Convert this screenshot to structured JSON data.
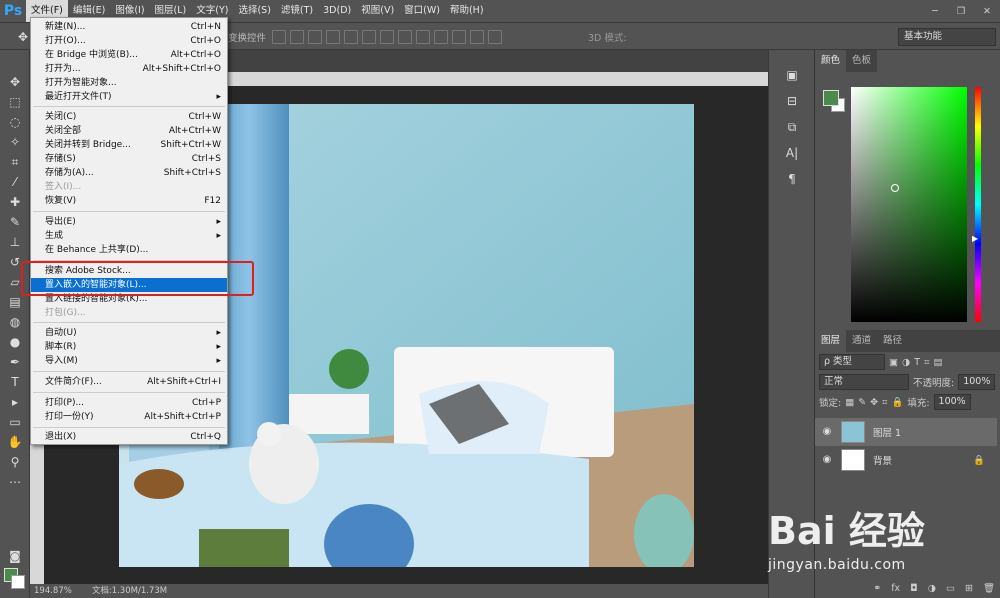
{
  "app": {
    "logo": "Ps"
  },
  "menubar": [
    "文件(F)",
    "编辑(E)",
    "图像(I)",
    "图层(L)",
    "文字(Y)",
    "选择(S)",
    "滤镜(T)",
    "3D(D)",
    "视图(V)",
    "窗口(W)",
    "帮助(H)"
  ],
  "options": {
    "autoselect_fragment": "变换控件",
    "mode3d": "3D 模式:",
    "workspace": "基本功能"
  },
  "file_menu": [
    {
      "label": "新建(N)...",
      "shortcut": "Ctrl+N"
    },
    {
      "label": "打开(O)...",
      "shortcut": "Ctrl+O"
    },
    {
      "label": "在 Bridge 中浏览(B)...",
      "shortcut": "Alt+Ctrl+O"
    },
    {
      "label": "打开为...",
      "shortcut": "Alt+Shift+Ctrl+O"
    },
    {
      "label": "打开为智能对象...",
      "shortcut": ""
    },
    {
      "label": "最近打开文件(T)",
      "shortcut": "▸"
    },
    {
      "label": "关闭(C)",
      "shortcut": "Ctrl+W"
    },
    {
      "label": "关闭全部",
      "shortcut": "Alt+Ctrl+W"
    },
    {
      "label": "关闭并转到 Bridge...",
      "shortcut": "Shift+Ctrl+W"
    },
    {
      "label": "存储(S)",
      "shortcut": "Ctrl+S"
    },
    {
      "label": "存储为(A)...",
      "shortcut": "Shift+Ctrl+S"
    },
    {
      "label": "签入(I)...",
      "shortcut": ""
    },
    {
      "label": "恢复(V)",
      "shortcut": "F12"
    },
    {
      "label": "导出(E)",
      "shortcut": "▸"
    },
    {
      "label": "生成",
      "shortcut": "▸"
    },
    {
      "label": "在 Behance 上共享(D)...",
      "shortcut": ""
    },
    {
      "label": "搜索 Adobe Stock...",
      "shortcut": ""
    },
    {
      "label": "置入嵌入的智能对象(L)...",
      "shortcut": ""
    },
    {
      "label": "置入链接的智能对象(K)...",
      "shortcut": ""
    },
    {
      "label": "打包(G)...",
      "shortcut": ""
    },
    {
      "label": "自动(U)",
      "shortcut": "▸"
    },
    {
      "label": "脚本(R)",
      "shortcut": "▸"
    },
    {
      "label": "导入(M)",
      "shortcut": "▸"
    },
    {
      "label": "文件简介(F)...",
      "shortcut": "Alt+Shift+Ctrl+I"
    },
    {
      "label": "打印(P)...",
      "shortcut": "Ctrl+P"
    },
    {
      "label": "打印一份(Y)",
      "shortcut": "Alt+Shift+Ctrl+P"
    },
    {
      "label": "退出(X)",
      "shortcut": "Ctrl+Q"
    }
  ],
  "color_panel": {
    "tabs": [
      "颜色",
      "色板"
    ],
    "foreground": "#4a8a4a",
    "background": "#ffffff"
  },
  "layers_panel": {
    "tabs": [
      "图层",
      "通道",
      "路径"
    ],
    "filter": "ρ 类型",
    "blend_mode": "正常",
    "opacity_label": "不透明度:",
    "opacity": "100%",
    "lock_label": "锁定:",
    "fill_label": "填充:",
    "fill": "100%",
    "layers": [
      "图层 1",
      "背景"
    ]
  },
  "status": {
    "zoom": "194.87%",
    "doc": "文档:1.30M/1.73M"
  },
  "watermark": {
    "brand": "Bai 经验",
    "url": "jingyan.baidu.com"
  }
}
